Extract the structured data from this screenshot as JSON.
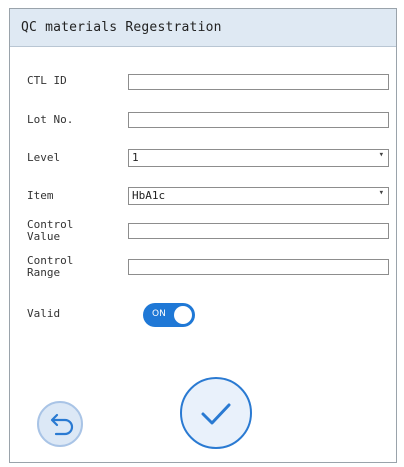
{
  "window": {
    "title": "QC materials Regestration"
  },
  "form": {
    "ctl_id": {
      "label": "CTL ID",
      "value": ""
    },
    "lot_no": {
      "label": "Lot No.",
      "value": ""
    },
    "level": {
      "label": "Level",
      "value": "1"
    },
    "item": {
      "label": "Item",
      "value": "HbA1c"
    },
    "control_value": {
      "label_line1": "Control",
      "label_line2": "Value",
      "value": ""
    },
    "control_range": {
      "label_line1": "Control",
      "label_line2": "Range",
      "value": ""
    },
    "valid": {
      "label": "Valid",
      "state": "ON"
    }
  },
  "icons": {
    "dropdown": "chevron-down-icon",
    "back": "undo-arrow-icon",
    "confirm": "checkmark-icon"
  },
  "colors": {
    "title_bg": "#dfe9f3",
    "accent": "#1f78d6",
    "back_button_bg": "#dce8f6"
  }
}
